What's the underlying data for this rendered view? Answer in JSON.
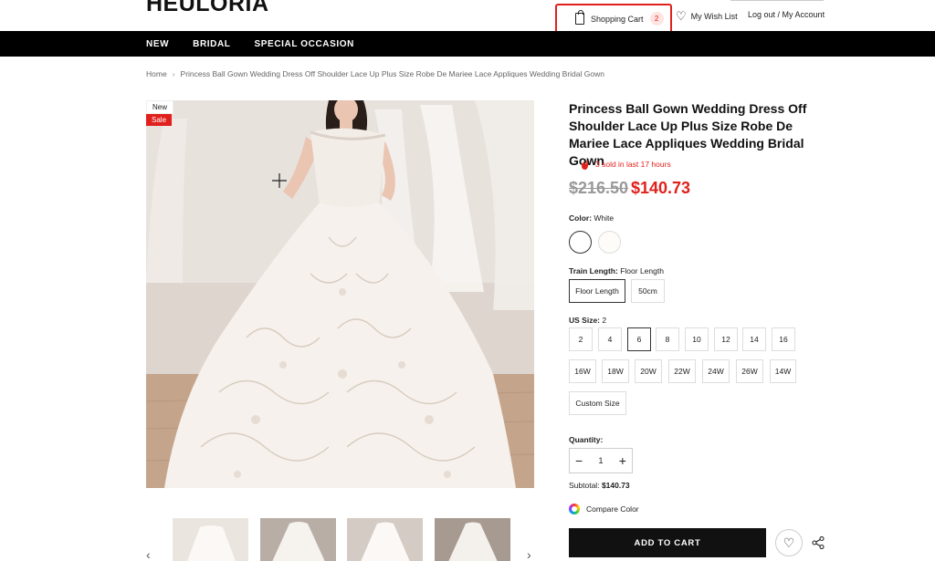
{
  "header": {
    "logo": "HEULORIA",
    "cart_label": "Shopping Cart",
    "cart_count": "2",
    "wishlist_label": "My Wish List",
    "logout_label": "Log out",
    "account_separator": " / ",
    "account_label": "My Account"
  },
  "nav": {
    "items": [
      "NEW",
      "BRIDAL",
      "SPECIAL OCCASION"
    ]
  },
  "breadcrumb": {
    "home": "Home",
    "current": "Princess Ball Gown Wedding Dress Off Shoulder Lace Up Plus Size Robe De Mariee Lace Appliques Wedding Bridal Gown"
  },
  "badges": {
    "new": "New",
    "sale": "Sale"
  },
  "product": {
    "title": "Princess Ball Gown Wedding Dress Off Shoulder Lace Up Plus Size Robe De Mariee Lace Appliques Wedding Bridal Gown",
    "sold_text": "3 sold in last 17 hours",
    "price_old": "$216.50",
    "price_new": "$140.73",
    "color": {
      "label": "Color:",
      "value": "White",
      "swatches": [
        "white",
        "ivory"
      ]
    },
    "train_length": {
      "label": "Train Length:",
      "value": "Floor Length",
      "options": [
        "Floor Length",
        "50cm"
      ]
    },
    "us_size": {
      "label": "US Size:",
      "value": "2",
      "options": [
        "2",
        "4",
        "6",
        "8",
        "10",
        "12",
        "14",
        "16",
        "16W",
        "18W",
        "20W",
        "22W",
        "24W",
        "26W",
        "14W",
        "Custom Size"
      ]
    },
    "quantity_label": "Quantity:",
    "quantity": "1",
    "subtotal_label": "Subtotal:",
    "subtotal_value": "$140.73",
    "compare_label": "Compare Color",
    "add_to_cart": "ADD TO CART"
  },
  "colors": {
    "accent": "#e0201c",
    "nav_bg": "#000000",
    "button_bg": "#111111"
  }
}
